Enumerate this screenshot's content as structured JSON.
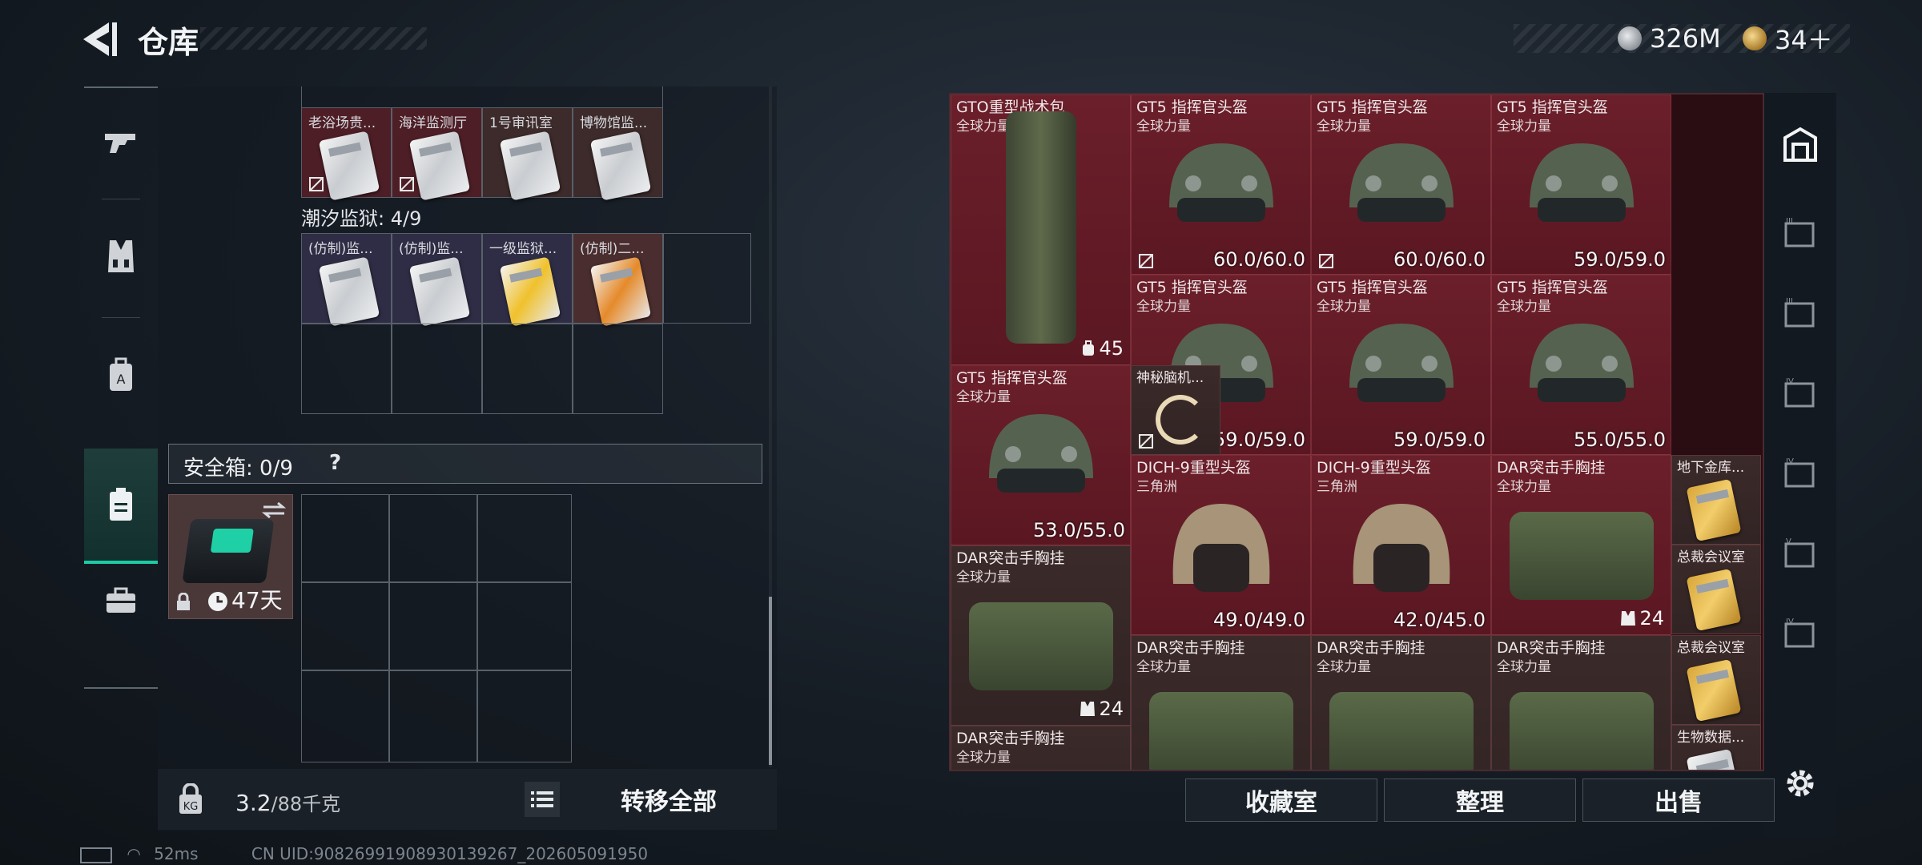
{
  "header": {
    "title": "仓库",
    "money": "326M",
    "coins": "34＋"
  },
  "warehouse_top": {
    "cards": [
      {
        "label": "老浴场贵..."
      },
      {
        "label": "海洋监测厅"
      },
      {
        "label": "1号审讯室"
      },
      {
        "label": "博物馆监..."
      }
    ]
  },
  "prison": {
    "title": "潮汐监狱: 4/9",
    "cards": [
      {
        "label": "(仿制)监..."
      },
      {
        "label": "(仿制)监..."
      },
      {
        "label": "一级监狱..."
      },
      {
        "label": "(仿制)二..."
      }
    ]
  },
  "safebox": {
    "label": "安全箱: 0/9",
    "help": "?",
    "timer": "47天"
  },
  "footer_left": {
    "weight": "3.2",
    "weight_max": "/88千克",
    "transfer_all": "转移全部"
  },
  "items": [
    {
      "name": "GTO重型战术包",
      "sub": "全球力量",
      "count": "45"
    },
    {
      "name": "GT5 指挥官头盔",
      "sub": "全球力量",
      "dur": "60.0/60.0"
    },
    {
      "name": "GT5 指挥官头盔",
      "sub": "全球力量",
      "dur": "60.0/60.0"
    },
    {
      "name": "GT5 指挥官头盔",
      "sub": "全球力量",
      "dur": "59.0/59.0"
    },
    {
      "name": "GT5 指挥官头盔",
      "sub": "全球力量",
      "dur": "59.0/59.0"
    },
    {
      "name": "GT5 指挥官头盔",
      "sub": "全球力量",
      "dur": "59.0/59.0"
    },
    {
      "name": "GT5 指挥官头盔",
      "sub": "全球力量",
      "dur": "55.0/55.0"
    },
    {
      "name": "GT5 指挥官头盔",
      "sub": "全球力量",
      "dur": "53.0/55.0"
    },
    {
      "name": "神秘脑机..."
    },
    {
      "name": "DICH-9重型头盔",
      "sub": "三角洲",
      "dur": "49.0/49.0"
    },
    {
      "name": "DICH-9重型头盔",
      "sub": "三角洲",
      "dur": "42.0/45.0"
    },
    {
      "name": "DAR突击手胸挂",
      "sub": "全球力量",
      "count": "24"
    },
    {
      "name": "地下金库..."
    },
    {
      "name": "总裁会议室"
    },
    {
      "name": "DAR突击手胸挂",
      "sub": "全球力量",
      "count": "24"
    },
    {
      "name": "DAR突击手胸挂",
      "sub": "全球力量"
    },
    {
      "name": "DAR突击手胸挂",
      "sub": "全球力量"
    },
    {
      "name": "DAR突击手胸挂",
      "sub": "全球力量"
    },
    {
      "name": "总裁会议室"
    },
    {
      "name": "DAR突击手胸挂",
      "sub": "全球力量"
    },
    {
      "name": "生物数据..."
    }
  ],
  "actions": {
    "collection": "收藏室",
    "sort": "整理",
    "sell": "出售"
  },
  "status": {
    "ping": "52ms",
    "uid": "CN UID:9082699190893013926​7_202605091950"
  }
}
